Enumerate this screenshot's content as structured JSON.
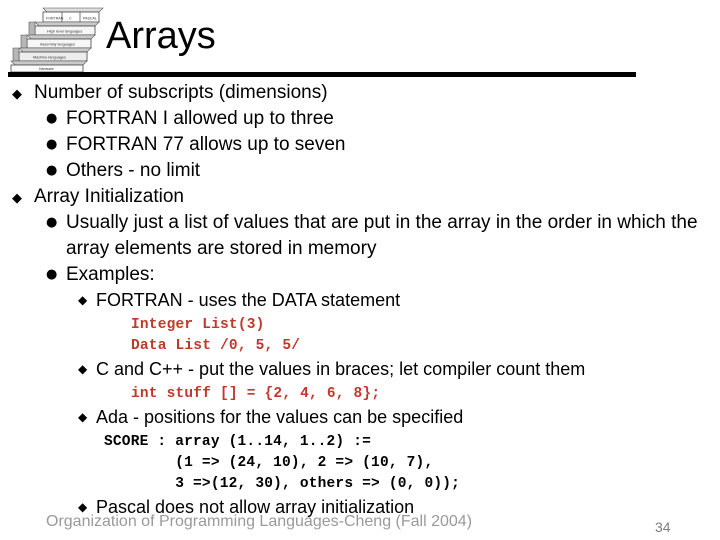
{
  "slide": {
    "title": "Arrays",
    "logo_icon": "layered-pyramid-logo",
    "logo_layers": [
      "FORTRAN   C   PASCAL",
      "High level languages",
      "Assembly languages",
      "Machine languages",
      "Hardware"
    ]
  },
  "content": [
    {
      "level": 1,
      "bullet": "◆",
      "text": "Number of subscripts (dimensions)"
    },
    {
      "level": 2,
      "bullet": "●",
      "text": "FORTRAN I allowed up to three"
    },
    {
      "level": 2,
      "bullet": "●",
      "text": "FORTRAN 77 allows up to seven"
    },
    {
      "level": 2,
      "bullet": "●",
      "text": "Others - no limit"
    },
    {
      "level": 1,
      "bullet": "◆",
      "text": "Array Initialization"
    },
    {
      "level": 2,
      "bullet": "●",
      "text": "Usually just a list of values that are put in the array in the order in which the array elements are stored in memory"
    },
    {
      "level": 2,
      "bullet": "●",
      "text": "Examples:"
    },
    {
      "level": 3,
      "bullet": "◆",
      "text": "FORTRAN - uses the DATA statement"
    },
    {
      "level": 3,
      "bullet": "◆",
      "text": "C and C++ - put the values in braces; let compiler count them"
    },
    {
      "level": 3,
      "bullet": "◆",
      "text": "Ada - positions for the values can be specified"
    },
    {
      "level": 3,
      "bullet": "◆",
      "text": "Pascal does not allow array initialization"
    }
  ],
  "code": {
    "fortran": {
      "color": "#C0392B",
      "lines": [
        "Integer List(3)",
        "Data List /0, 5, 5/"
      ]
    },
    "c": {
      "color": "#C0392B",
      "lines": [
        "int stuff [] = {2, 4, 6, 8};"
      ]
    },
    "ada": {
      "color": "#000000",
      "lines": [
        "SCORE : array (1..14, 1..2) :=",
        "        (1 => (24, 10), 2 => (10, 7),",
        "        3 =>(12, 30), others => (0, 0));"
      ]
    }
  },
  "footer": {
    "note": "Organization of Programming Languages-Cheng (Fall 2004)",
    "page_number": "34"
  },
  "colors": {
    "text": "#000000",
    "code_red": "#C0392B",
    "footer_gray": "#9a9a9a",
    "rule": "#000000",
    "background": "#ffffff"
  }
}
